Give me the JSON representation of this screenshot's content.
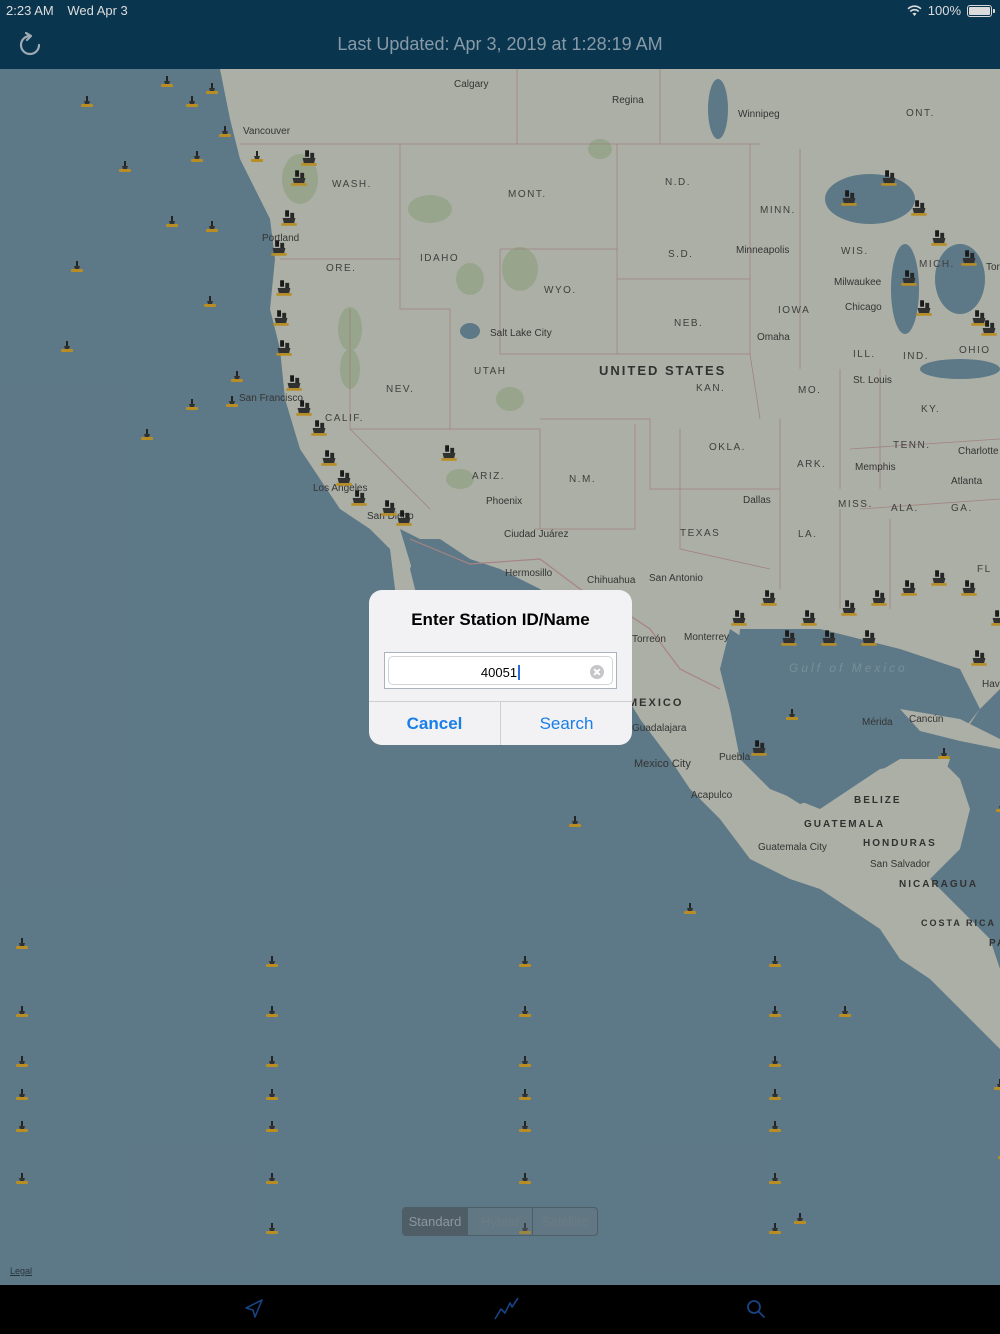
{
  "status_bar": {
    "time": "2:23 AM",
    "date": "Wed Apr 3",
    "battery": "100%",
    "battery_level": 1.0,
    "icons": [
      "wifi-icon",
      "battery-icon"
    ]
  },
  "nav_bar": {
    "title": "Last Updated: Apr 3, 2019 at 1:28:19 AM",
    "refresh_icon": "refresh-icon"
  },
  "map": {
    "state_labels": [
      "WASH.",
      "MONT.",
      "N.D.",
      "MINN.",
      "ORE.",
      "IDAHO",
      "S.D.",
      "WYO.",
      "WIS.",
      "MICH.",
      "IOWA",
      "NEB.",
      "NEV.",
      "UTAH",
      "ILL.",
      "IND.",
      "OHIO",
      "CALIF.",
      "KAN.",
      "MO.",
      "KY.",
      "TENN.",
      "ARIZ.",
      "N.M.",
      "OKLA.",
      "ARK.",
      "MISS.",
      "ALA.",
      "GA.",
      "TEXAS",
      "LA.",
      "ONT.",
      "FL"
    ],
    "city_labels": [
      "Calgary",
      "Regina",
      "Winnipeg",
      "Vancouver",
      "Portland",
      "Minneapolis",
      "Milwaukee",
      "Chicago",
      "Salt Lake City",
      "Omaha",
      "St. Louis",
      "San Francisco",
      "Los Angeles",
      "San Diego",
      "Phoenix",
      "Memphis",
      "Charlotte",
      "Atlanta",
      "Dallas",
      "Ciudad Juárez",
      "Hermosillo",
      "Chihuahua",
      "San Antonio",
      "Monterrey",
      "Torreón",
      "Guadalajara",
      "Mexico City",
      "Puebla",
      "Acapulco",
      "Mérida",
      "Cancún",
      "Guatemala City",
      "San Salvador",
      "Havana",
      "Toronto"
    ],
    "country_labels": [
      "UNITED STATES",
      "MEXICO",
      "BELIZE",
      "GUATEMALA",
      "HONDURAS",
      "NICARAGUA",
      "COSTA RICA",
      "PA"
    ],
    "sea_labels": [
      "Gulf of Mexico"
    ],
    "legal_link": "Legal",
    "colors": {
      "ocean": "#6d8c9d",
      "land": "#c9ccc1",
      "park": "#aebfa0",
      "buoy": "#d6a52b"
    }
  },
  "map_type": {
    "options": [
      "Standard",
      "Hybrid",
      "Satellite"
    ],
    "selected": "Standard"
  },
  "dialog": {
    "title": "Enter Station ID/Name",
    "input_value": "40051",
    "cancel_label": "Cancel",
    "search_label": "Search"
  },
  "tab_bar": {
    "items": [
      {
        "icon": "location-arrow-icon"
      },
      {
        "icon": "chart-icon"
      },
      {
        "icon": "search-icon"
      }
    ]
  }
}
